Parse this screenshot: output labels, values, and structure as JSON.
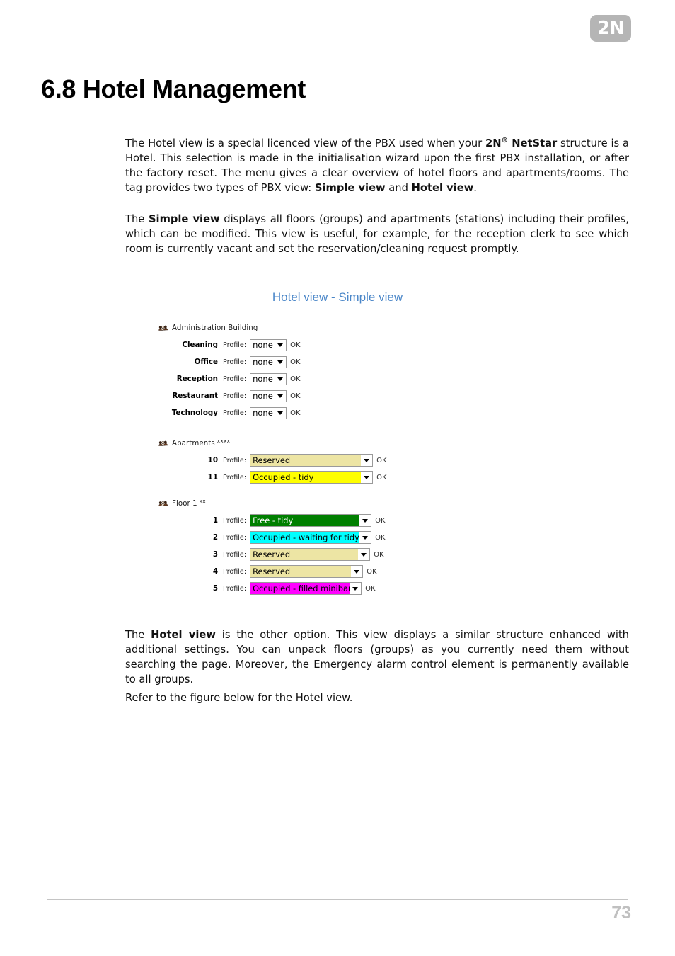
{
  "header": {
    "logo_text": "2N"
  },
  "heading": "6.8 Hotel Management",
  "paragraphs": {
    "p1_a": "The Hotel view is a special licenced view of the PBX used when your ",
    "p1_brand": "2N",
    "p1_sup": "®",
    "p1_brand2": " NetStar",
    "p1_b": " structure is a Hotel. This selection is made in the initialisation wizard upon the first PBX installation, or after the factory reset. The menu gives a clear overview of hotel floors and apartments/rooms. The tag provides two types of PBX view: ",
    "p1_bold1": "Simple view",
    "p1_c": " and ",
    "p1_bold2": "Hotel view",
    "p1_d": ".",
    "p2_a": "The ",
    "p2_bold": "Simple view",
    "p2_b": " displays all floors (groups) and apartments (stations) including their profiles, which can be modified. This view is useful, for example, for the reception clerk to see which room is currently vacant and set the reservation/cleaning request promptly.",
    "p3_a": "The ",
    "p3_bold": "Hotel view",
    "p3_b": " is the other option. This view displays a similar structure enhanced with additional settings. You can unpack floors (groups) as you currently need them without searching the page. Moreover, the Emergency alarm control element is permanently available to all groups.",
    "p4": "Refer to the figure below for the Hotel view."
  },
  "figure": {
    "caption": "Hotel view - Simple view",
    "groups": [
      {
        "id": "admin",
        "icon": "group-people-icon",
        "name": "Administration Building",
        "mark": "",
        "rows": [
          {
            "label": "Cleaning",
            "profile_label": "Profile:",
            "value": "none",
            "ok": "OK",
            "color": "#ffffff",
            "text_color": "#000000",
            "label_width": 62,
            "select_width": 52
          },
          {
            "label": "Office",
            "profile_label": "Profile:",
            "value": "none",
            "ok": "OK",
            "color": "#ffffff",
            "text_color": "#000000",
            "label_width": 48,
            "select_width": 52
          },
          {
            "label": "Reception",
            "profile_label": "Profile:",
            "value": "none",
            "ok": "OK",
            "color": "#ffffff",
            "text_color": "#000000",
            "label_width": 68,
            "select_width": 52
          },
          {
            "label": "Restaurant",
            "profile_label": "Profile:",
            "value": "none",
            "ok": "OK",
            "color": "#ffffff",
            "text_color": "#000000",
            "label_width": 72,
            "select_width": 52
          },
          {
            "label": "Technology",
            "profile_label": "Profile:",
            "value": "none",
            "ok": "OK",
            "color": "#ffffff",
            "text_color": "#000000",
            "label_width": 76,
            "select_width": 52
          }
        ]
      },
      {
        "id": "apartments",
        "icon": "group-people-icon",
        "name": "Apartments",
        "mark": "xxxx",
        "rows": [
          {
            "label": "10",
            "profile_label": "Profile:",
            "value": "Reserved",
            "ok": "OK",
            "color": "#ede5a4",
            "text_color": "#000000",
            "label_width": 32,
            "select_width": 174
          },
          {
            "label": "11",
            "profile_label": "Profile:",
            "value": "Occupied - tidy",
            "ok": "OK",
            "color": "#ffff00",
            "text_color": "#000000",
            "label_width": 32,
            "select_width": 174
          }
        ]
      },
      {
        "id": "floor1",
        "icon": "group-people-icon",
        "name": "Floor 1",
        "mark": "xx",
        "rows": [
          {
            "label": "1",
            "profile_label": "Profile:",
            "value": "Free - tidy",
            "ok": "OK",
            "color": "#007f00",
            "text_color": "#ffffff",
            "label_width": 24,
            "select_width": 172
          },
          {
            "label": "2",
            "profile_label": "Profile:",
            "value": "Occupied - waiting for tidying",
            "ok": "OK",
            "color": "#00ffff",
            "text_color": "#000000",
            "label_width": 24,
            "select_width": 172
          },
          {
            "label": "3",
            "profile_label": "Profile:",
            "value": "Reserved",
            "ok": "OK",
            "color": "#ede5a4",
            "text_color": "#000000",
            "label_width": 24,
            "select_width": 170
          },
          {
            "label": "4",
            "profile_label": "Profile:",
            "value": "Reserved",
            "ok": "OK",
            "color": "#ede5a4",
            "text_color": "#000000",
            "label_width": 24,
            "select_width": 160
          },
          {
            "label": "5",
            "profile_label": "Profile:",
            "value": "Occupied - filled minibar",
            "ok": "OK",
            "color": "#ff00ff",
            "text_color": "#000000",
            "label_width": 24,
            "select_width": 158
          }
        ]
      }
    ]
  },
  "footer": {
    "page_number": "73"
  }
}
